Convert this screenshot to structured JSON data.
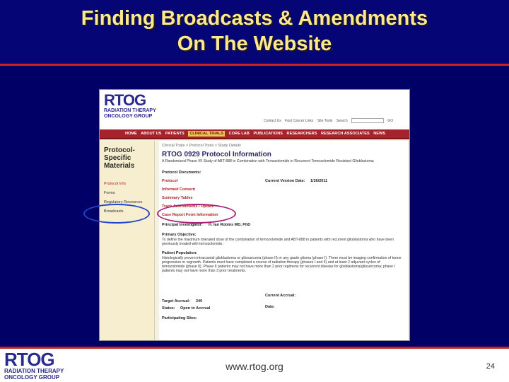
{
  "slide": {
    "title_line1": "Finding Broadcasts & Amendments",
    "title_line2": "On The Website",
    "footer_url": "www.rtog.org",
    "page_number": "24",
    "footer_logo": {
      "mark": "RTOG",
      "sub1": "RADIATION THERAPY",
      "sub2": "ONCOLOGY GROUP"
    },
    "colors": {
      "background": "#000066",
      "title": "#ffe98a",
      "accent": "#cc2222"
    }
  },
  "website": {
    "logo": {
      "mark": "RTOG",
      "sub1": "RADIATION THERAPY",
      "sub2": "ONCOLOGY GROUP"
    },
    "toplinks": [
      "Contact Us",
      "Fast Cancer Links",
      "Site Tools",
      "Search"
    ],
    "search_go": "GO",
    "nav": [
      "HOME",
      "ABOUT US",
      "PATIENTS",
      "CLINICAL TRIALS",
      "CORE LAB",
      "PUBLICATIONS",
      "RESEARCHERS",
      "RESEARCH ASSOCIATES",
      "NEWS"
    ],
    "nav_active": "CLINICAL TRIALS",
    "sidebar": {
      "heading_line1": "Protocol-",
      "heading_line2": "Specific",
      "heading_line3": "Materials",
      "links": [
        "Protocol Info",
        "Forms",
        "Regulatory Resources",
        "Broadcasts"
      ]
    },
    "breadcrumb": "Clinical Trials > Protocol Tools > Study Details",
    "protocol_title": "RTOG 0929 Protocol Information",
    "protocol_desc": "A Randomized Phase I/II Study of ABT-888 in Combination with Temozolomide in Recurrent Temozolomide Resistant Glioblastoma",
    "protocol_documents_label": "Protocol Documents:",
    "doc_links": [
      "Protocol",
      "Informed Consent",
      "Summary Tables",
      "Track Amendments / Update",
      "Case Report Form Information"
    ],
    "current_version_label": "Current Version Date:",
    "current_version_date": "1/26/2011",
    "principal_investigator_label": "Principal Investigator:",
    "principal_investigator": "H. Ian Robins MD, PhD",
    "primary_objective_label": "Primary Objective:",
    "primary_objective": "To define the maximum tolerated dose of the combination of temozolomide and ABT-888 in patients with recurrent glioblastoma who have been previously treated with temozolomide.",
    "patient_population_label": "Patient Population:",
    "patient_population": "Histologically proven intracranial glioblastoma or gliosarcoma (phase II) or any grade glioma (phase I). There must be imaging confirmation of tumor progression or regrowth. Patients must have completed a course of radiation therapy (phases I and II) and at least 2 adjuvant cycles of temozolomide (phase II). Phase II patients may not have more than 2 prior regimens for recurrent disease for glioblastoma/gliosarcoma; phase I patients may not have more than 3 prior treatments.",
    "target_accrual_label": "Target Accrual:",
    "target_accrual": "240",
    "current_accrual_label": "Current Accrual:",
    "status_label": "Status:",
    "status": "Open to Accrual",
    "date_label": "Date:",
    "participating_sites_label": "Participating Sites:"
  }
}
